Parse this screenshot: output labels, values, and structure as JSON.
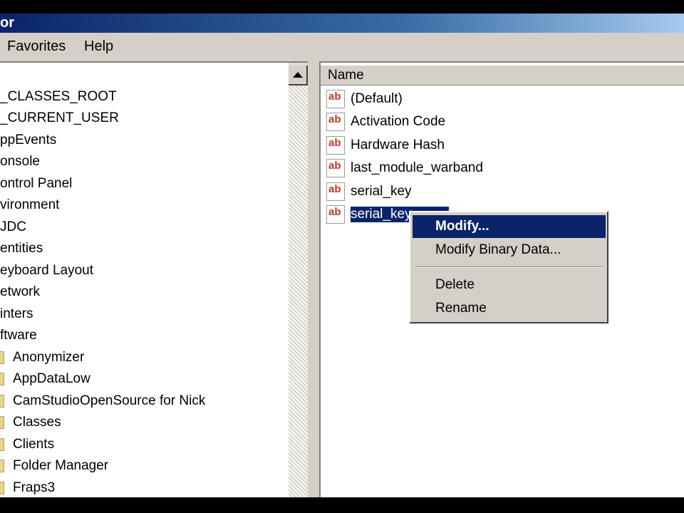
{
  "window": {
    "title_fragment": "or"
  },
  "menu": {
    "favorites": "Favorites",
    "help": "Help"
  },
  "tree": {
    "items": [
      "_CLASSES_ROOT",
      "_CURRENT_USER",
      "ppEvents",
      "onsole",
      "ontrol Panel",
      "vironment",
      "JDC",
      "entities",
      "eyboard Layout",
      "etwork",
      "inters",
      "ftware"
    ],
    "subitems": [
      "Anonymizer",
      "AppDataLow",
      "CamStudioOpenSource for Nick",
      "Classes",
      "Clients",
      "Folder Manager",
      "Fraps3"
    ]
  },
  "list": {
    "header": "Name",
    "values": [
      {
        "icon": "ab",
        "name": "(Default)"
      },
      {
        "icon": "ab",
        "name": "Activation Code"
      },
      {
        "icon": "ab",
        "name": "Hardware Hash"
      },
      {
        "icon": "ab",
        "name": "last_module_warband"
      },
      {
        "icon": "ab",
        "name": "serial_key"
      },
      {
        "icon": "ab",
        "name": "serial_key"
      }
    ]
  },
  "context_menu": {
    "modify": "Modify...",
    "modify_binary": "Modify Binary Data...",
    "delete": "Delete",
    "rename": "Rename"
  },
  "colors": {
    "selection": "#0a246a",
    "title_gradient_start": "#0a246a",
    "icon_text": "#c0392b"
  }
}
